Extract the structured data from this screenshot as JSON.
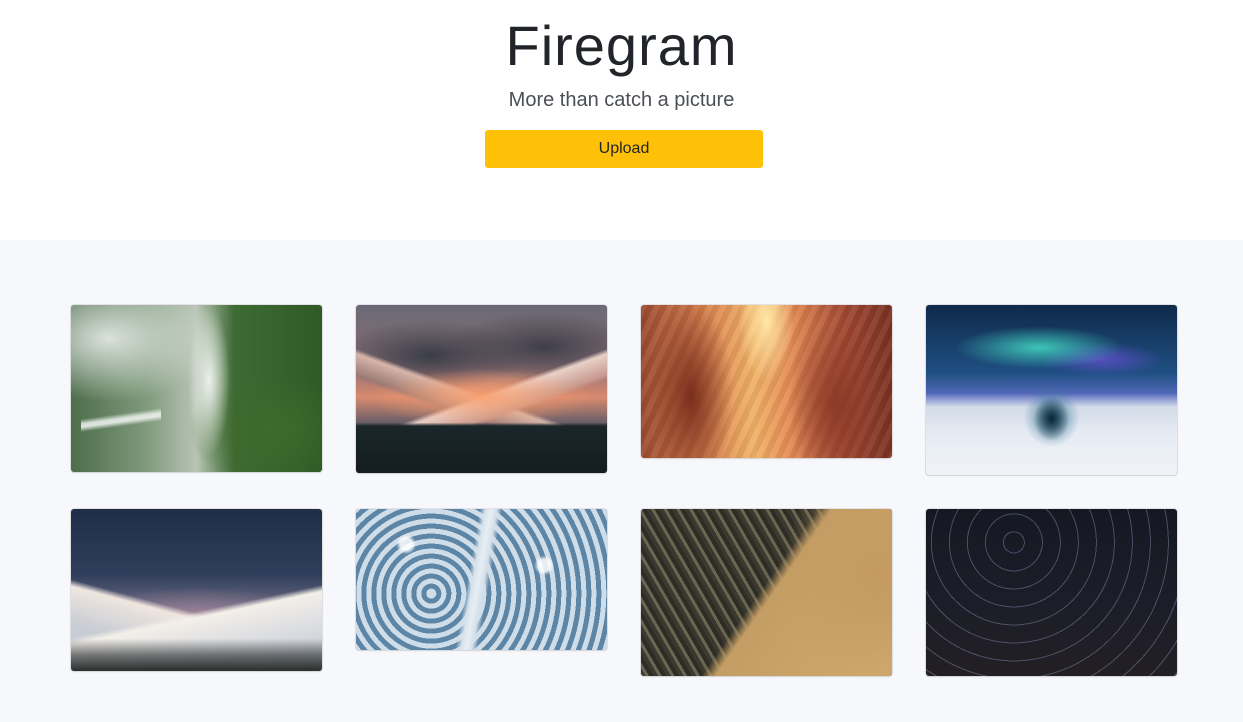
{
  "header": {
    "title": "Firegram",
    "subtitle": "More than catch a picture",
    "upload_label": "Upload"
  },
  "colors": {
    "accent": "#ffc107",
    "gallery_background": "#f7f8fb"
  },
  "gallery": {
    "photos": [
      {
        "subject": "waterfall in forest"
      },
      {
        "subject": "mountain at sunset"
      },
      {
        "subject": "sandstone canyon"
      },
      {
        "subject": "aurora over snow tunnel"
      },
      {
        "subject": "snowy mountains at night"
      },
      {
        "subject": "snowy forest road aerial"
      },
      {
        "subject": "desert erosion aerial"
      },
      {
        "subject": "star trails"
      }
    ]
  }
}
